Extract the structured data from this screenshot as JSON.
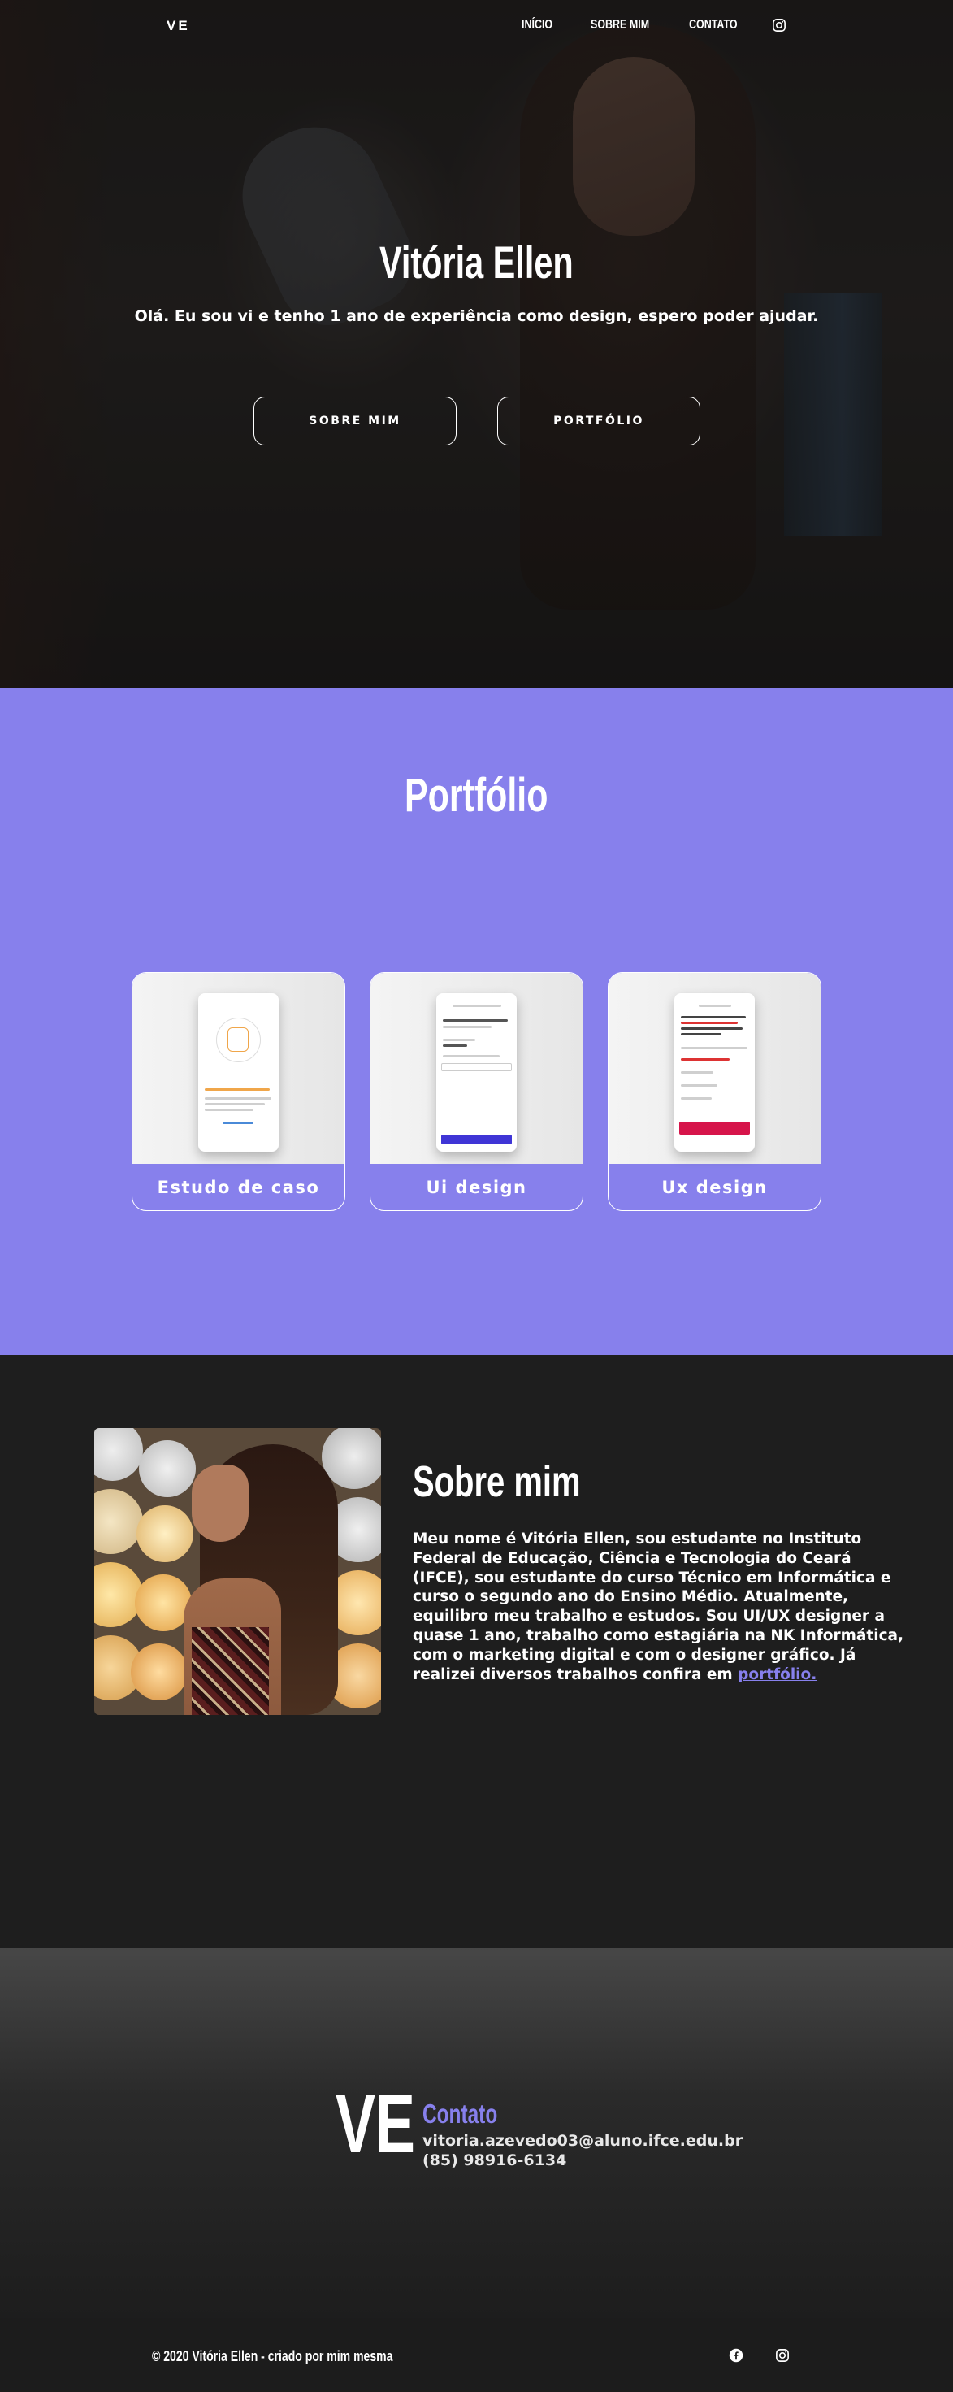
{
  "nav": {
    "brand": "VE",
    "links": [
      "INÍCIO",
      "SOBRE MIM",
      "CONTATO"
    ],
    "instagram_icon": "instagram-icon"
  },
  "hero": {
    "title": "Vitória Ellen",
    "subtitle": "Olá. Eu sou vi e tenho 1 ano de experiência como design, espero poder ajudar.",
    "buttons": [
      "SOBRE MIM",
      "PORTFÓLIO"
    ]
  },
  "portfolio": {
    "title": "Portfólio",
    "cards": [
      {
        "label": "Estudo de caso"
      },
      {
        "label": "Ui design"
      },
      {
        "label": "Ux design"
      }
    ]
  },
  "about": {
    "title": "Sobre mim",
    "text": "Meu nome é Vitória Ellen, sou estudante no Instituto Federal de Educação, Ciência e Tecnologia do Ceará (IFCE), sou estudante do curso Técnico em Informática e curso o segundo ano do Ensino Médio. Atualmente, equilibro meu trabalho e estudos. Sou UI/UX designer a quase 1 ano, trabalho como estagiária na NK Informática, com o marketing digital e com o designer gráfico. Já realizei diversos trabalhos confira em ",
    "link": "portfólio."
  },
  "contact": {
    "logo": "VE",
    "title": "Contato",
    "email": "vitoria.azevedo03@aluno.ifce.edu.br",
    "phone": "(85) 98916-6134"
  },
  "footer": {
    "copyright": "© 2020 Vitória Ellen - criado por mim mesma",
    "icons": [
      "facebook-icon",
      "instagram-icon"
    ]
  },
  "colors": {
    "accent": "#8780ec",
    "dark": "#1e1e1e"
  }
}
